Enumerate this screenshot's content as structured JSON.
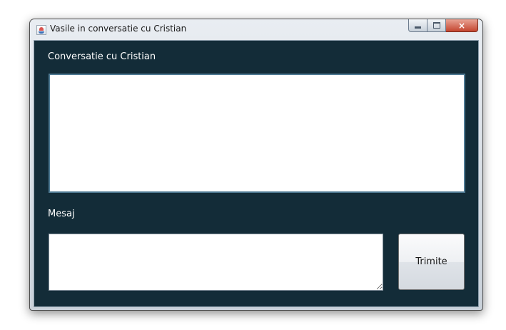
{
  "window": {
    "title": "Vasile in conversatie cu Cristian",
    "icon": "java-icon",
    "caption_buttons": [
      "minimize-icon",
      "maximize-icon",
      "close-icon"
    ],
    "close_glyph": "×"
  },
  "conversation": {
    "label": "Conversatie cu Cristian",
    "text": ""
  },
  "message": {
    "label": "Mesaj",
    "value": ""
  },
  "send_button": {
    "label": "Trimite"
  },
  "colors": {
    "background": "#132c38",
    "text": "#ffffff",
    "close_button": "#c4452f"
  }
}
